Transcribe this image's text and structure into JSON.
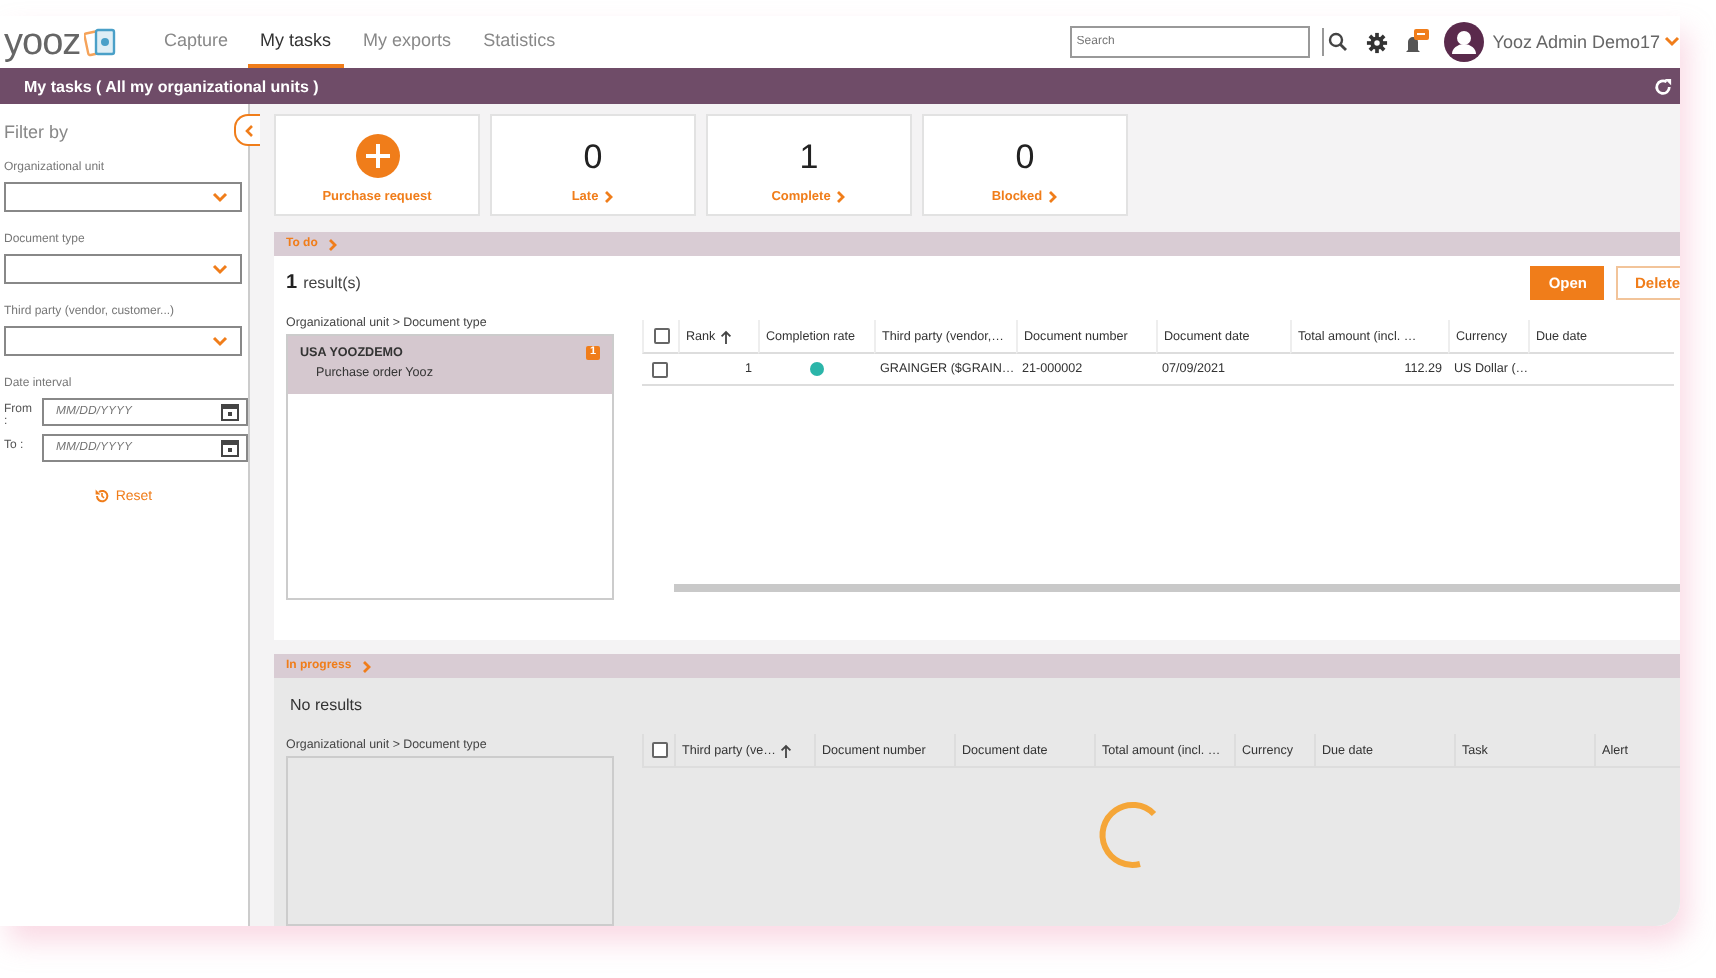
{
  "nav": {
    "logo": "yooz",
    "tabs": [
      {
        "label": "Capture",
        "selected": false
      },
      {
        "label": "My tasks",
        "selected": true
      },
      {
        "label": "My exports",
        "selected": false
      },
      {
        "label": "Statistics",
        "selected": false
      }
    ],
    "search": {
      "placeholder": "Search"
    },
    "user": "Yooz Admin Demo17"
  },
  "title_bar": {
    "title": "My tasks ( All my organizational units )"
  },
  "filters": {
    "title": "Filter by",
    "fields": [
      {
        "label": "Organizational unit"
      },
      {
        "label": "Document type"
      },
      {
        "label": "Third party (vendor, customer...)"
      }
    ],
    "date_interval": {
      "label": "Date interval",
      "from_label": "From :",
      "to_label": "To :",
      "from_placeholder": "MM/DD/YYYY",
      "to_placeholder": "MM/DD/YYYY"
    },
    "reset": "Reset"
  },
  "tiles": [
    {
      "kind": "action",
      "label": "Purchase request"
    },
    {
      "kind": "counter",
      "value": "0",
      "label": "Late"
    },
    {
      "kind": "counter",
      "value": "1",
      "label": "Complete"
    },
    {
      "kind": "counter",
      "value": "0",
      "label": "Blocked"
    }
  ],
  "todo": {
    "title": "To do",
    "count": "1",
    "count_label": "result(s)",
    "buttons": [
      {
        "label": "Open",
        "kind": "primary"
      },
      {
        "label": "Delete",
        "kind": "secondary"
      }
    ],
    "tree": {
      "heading": "Organizational unit > Document type",
      "items": [
        {
          "label": "USA YOOZDEMO",
          "badge": "1",
          "selected": true,
          "children": [
            {
              "label": "Purchase order Yooz"
            }
          ]
        }
      ]
    },
    "table": {
      "all_checked": false,
      "columns": [
        {
          "label": "Rank",
          "sorted": true
        },
        {
          "label": "Completion rate",
          "sorted": false
        },
        {
          "label": "Third party (vendor,…",
          "sorted": false
        },
        {
          "label": "Document number",
          "sorted": false
        },
        {
          "label": "Document date",
          "sorted": false
        },
        {
          "label": "Total amount (incl. …",
          "sorted": false
        },
        {
          "label": "Currency",
          "sorted": false
        },
        {
          "label": "Due date",
          "sorted": false
        }
      ],
      "rows": [
        {
          "checked": false,
          "rank": "1",
          "color": "#2bb5a9",
          "third_party": "GRAINGER ($GRAIN…",
          "document_number": "21-000002",
          "document_date": "07/09/2021",
          "total_amount": "112.29",
          "currency": "US Dollar (…"
        }
      ]
    }
  },
  "in_progress": {
    "title": "In progress",
    "message": "No results",
    "loading": true,
    "tree": {
      "heading": "Organizational unit > Document type"
    },
    "table": {
      "all_checked": false,
      "columns": [
        {
          "label": "Third party (ve…",
          "sorted": true
        },
        {
          "label": "Document number",
          "sorted": false
        },
        {
          "label": "Document date",
          "sorted": false
        },
        {
          "label": "Total amount (incl. …",
          "sorted": false
        },
        {
          "label": "Currency",
          "sorted": false
        },
        {
          "label": "Due date",
          "sorted": false
        },
        {
          "label": "Task",
          "sorted": false
        },
        {
          "label": "Alert",
          "sorted": false
        }
      ]
    }
  }
}
